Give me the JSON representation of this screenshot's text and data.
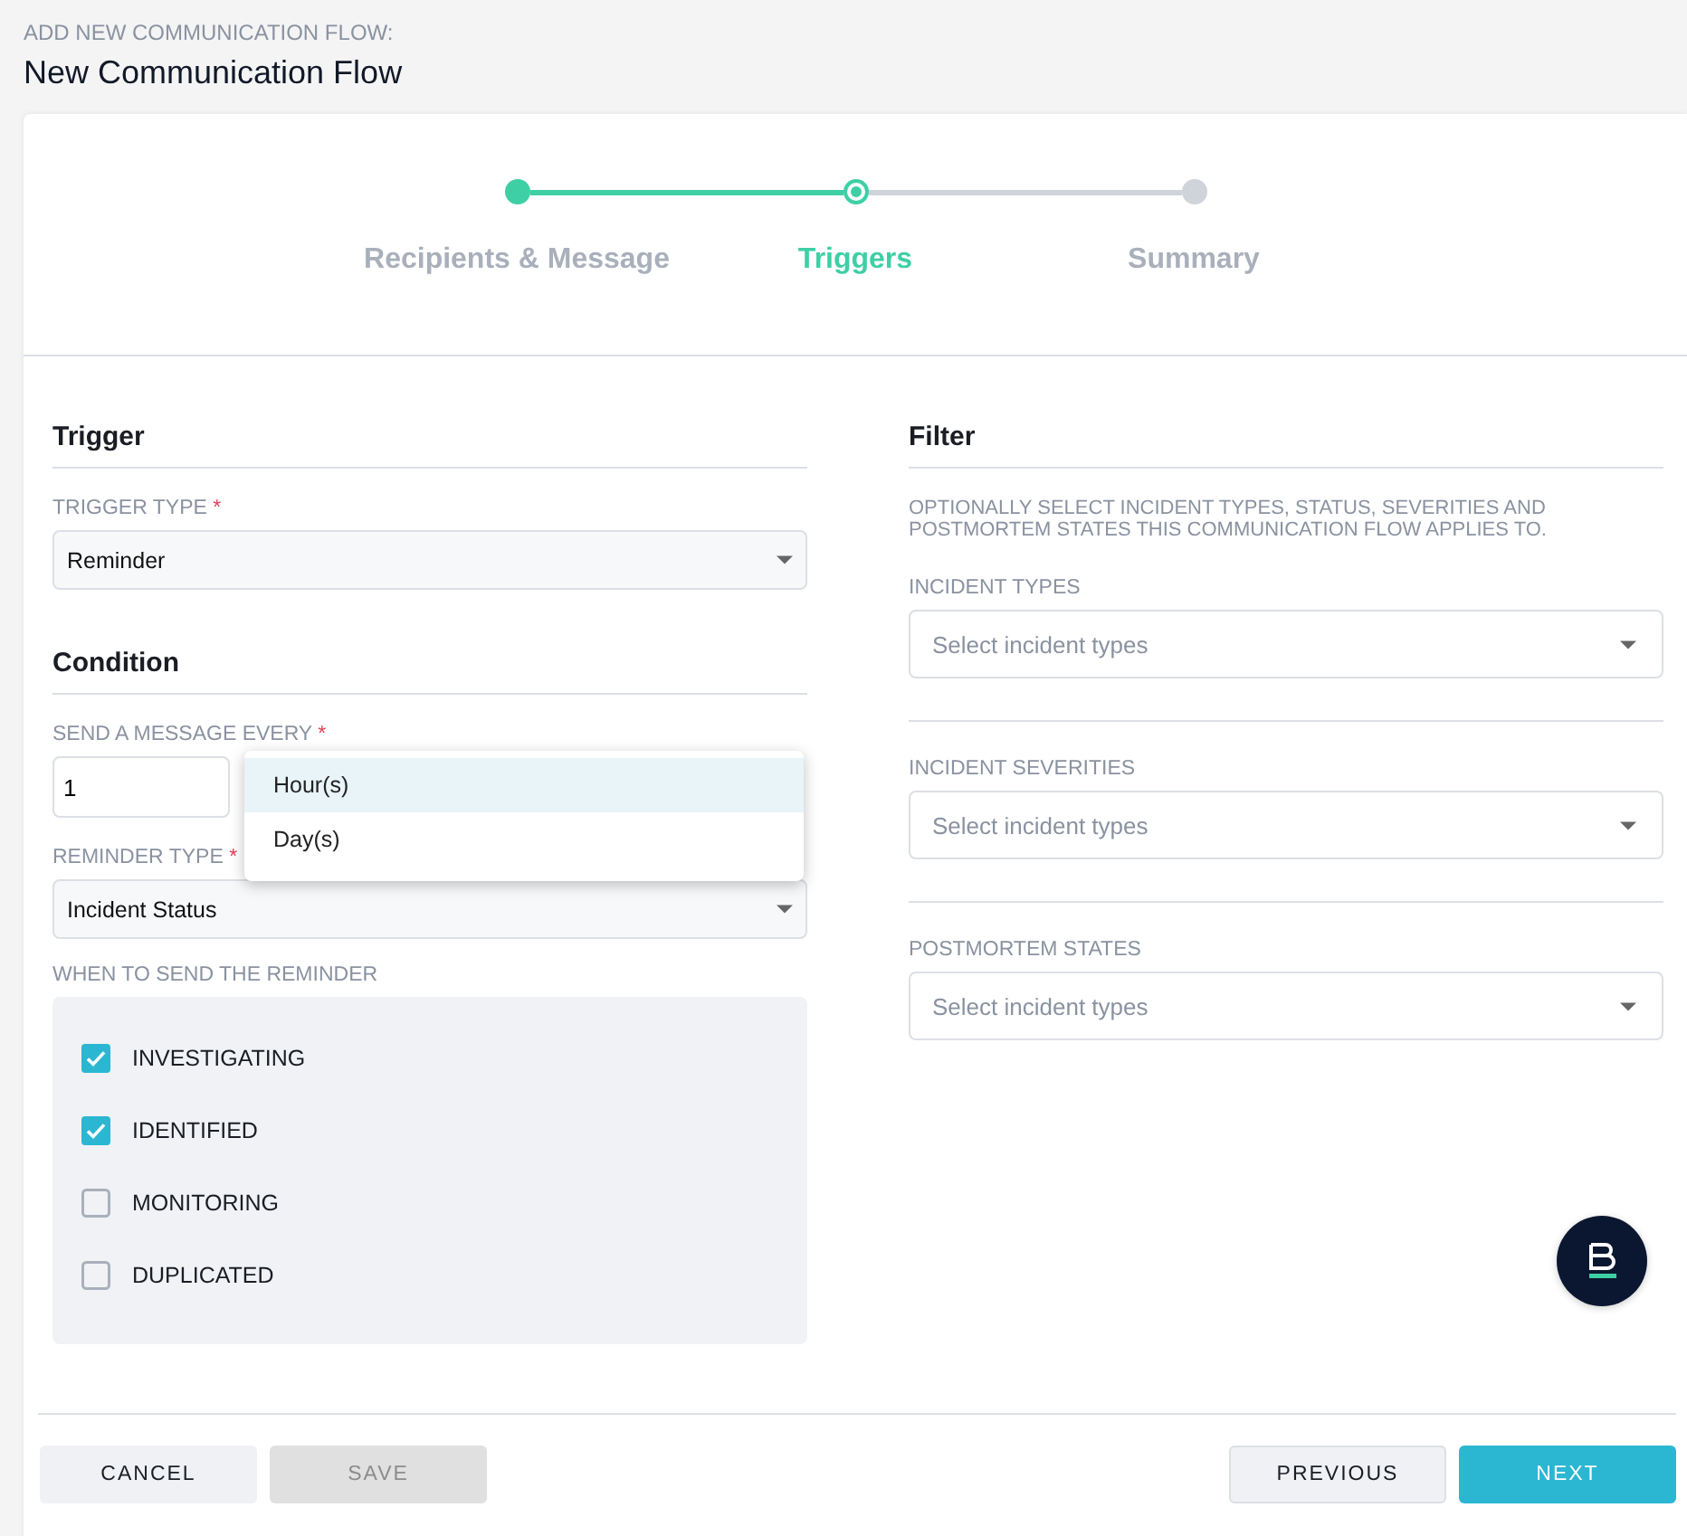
{
  "header": {
    "overline": "ADD NEW COMMUNICATION FLOW:",
    "title": "New Communication Flow"
  },
  "steps": [
    {
      "label": "Recipients & Message",
      "completed": true,
      "selected": false
    },
    {
      "label": "Triggers",
      "completed": false,
      "selected": true
    },
    {
      "label": "Summary",
      "completed": false,
      "selected": false
    }
  ],
  "trigger": {
    "heading": "Trigger",
    "type_label": "TRIGGER TYPE",
    "required": "*",
    "type_value": "Reminder"
  },
  "condition": {
    "heading": "Condition",
    "every_label": "SEND A MESSAGE EVERY",
    "every_required": "*",
    "every_value": "1",
    "reminder_label": "REMINDER TYPE",
    "reminder_required": "*",
    "reminder_value": "Incident Status",
    "when_label": "WHEN TO SEND THE REMINDER",
    "statuses": [
      {
        "label": "INVESTIGATING",
        "checked": true
      },
      {
        "label": "IDENTIFIED",
        "checked": true
      },
      {
        "label": "MONITORING",
        "checked": false
      },
      {
        "label": "DUPLICATED",
        "checked": false
      }
    ]
  },
  "unit_menu": [
    {
      "label": "Hour(s)",
      "selected": true
    },
    {
      "label": "Day(s)",
      "selected": false
    }
  ],
  "filter": {
    "heading": "Filter",
    "description": "OPTIONALLY SELECT INCIDENT TYPES, STATUS, SEVERITIES AND POSTMORTEM STATES THIS COMMUNICATION FLOW APPLIES TO.",
    "fields": [
      {
        "label": "INCIDENT TYPES",
        "placeholder": "Select incident types"
      },
      {
        "label": "INCIDENT SEVERITIES",
        "placeholder": "Select incident types"
      },
      {
        "label": "POSTMORTEM STATES",
        "placeholder": "Select incident types"
      }
    ]
  },
  "footer": {
    "cancel": "CANCEL",
    "save": "SAVE",
    "save_disabled": true,
    "previous": "PREVIOUS",
    "next": "NEXT"
  }
}
